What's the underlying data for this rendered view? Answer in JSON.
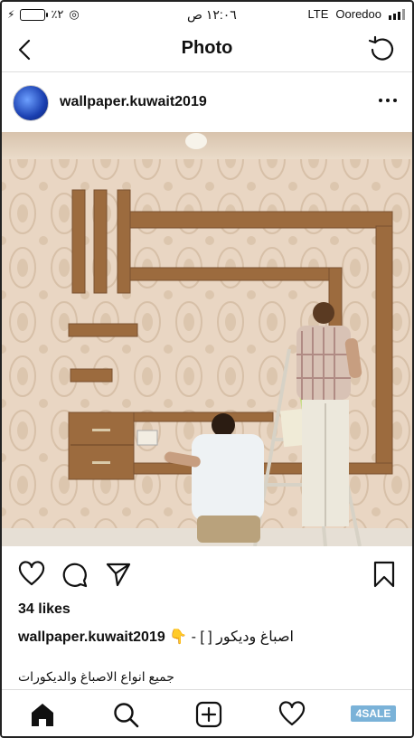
{
  "status_bar": {
    "battery_percent": "٪٢",
    "time": "١٢:٠٦ ص",
    "network": "LTE",
    "carrier": "Ooredoo"
  },
  "nav": {
    "title": "Photo"
  },
  "post": {
    "username": "wallpaper.kuwait2019",
    "likes": "34 likes",
    "caption_user": "wallpaper.kuwait2019",
    "caption_text": "اصباغ وديكور [ ] - 👇",
    "caption_line2": "جميع انواع الاصباغ والديكورات"
  },
  "watermark": "4SALE",
  "icons": {
    "back": "chevron-left-icon",
    "refresh": "refresh-icon",
    "more": "more-dots-icon",
    "like": "heart-icon",
    "comment": "comment-icon",
    "share": "send-icon",
    "save": "bookmark-icon",
    "home": "home-icon",
    "search": "search-icon",
    "add": "add-post-icon",
    "activity": "heart-icon"
  }
}
